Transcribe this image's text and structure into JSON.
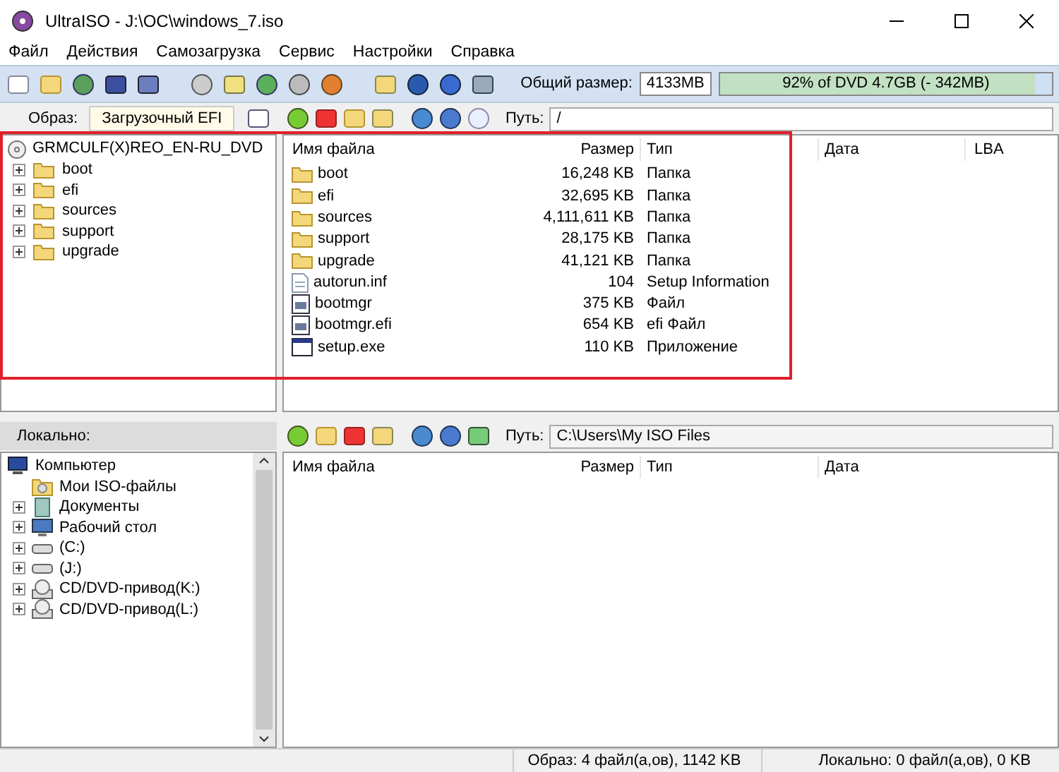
{
  "window": {
    "title": "UltraISO - J:\\OC\\windows_7.iso"
  },
  "menu": [
    "Файл",
    "Действия",
    "Самозагрузка",
    "Сервис",
    "Настройки",
    "Справка"
  ],
  "toolbar": {
    "total_label": "Общий размер:",
    "total_value": "4133MB",
    "capacity": {
      "reading": "92% of DVD 4.7GB (- 342MB)",
      "level": 0.95
    }
  },
  "image_bar": {
    "label": "Образ:",
    "boot_type": "Загрузочный EFI",
    "path_label": "Путь:",
    "path": "/"
  },
  "image_tree": {
    "root": "GRMCULF(X)REO_EN-RU_DVD",
    "children": [
      {
        "label": "boot",
        "expandable": true
      },
      {
        "label": "efi",
        "expandable": true
      },
      {
        "label": "sources",
        "expandable": true
      },
      {
        "label": "support",
        "expandable": true
      },
      {
        "label": "upgrade",
        "expandable": true
      }
    ]
  },
  "image_files": {
    "columns": [
      "Имя файла",
      "Размер",
      "Тип",
      "Дата",
      "LBA"
    ],
    "rows": [
      {
        "kind": "folder",
        "name": "boot",
        "size": "16,248 KB",
        "type": "Папка"
      },
      {
        "kind": "folder",
        "name": "efi",
        "size": "32,695 KB",
        "type": "Папка"
      },
      {
        "kind": "folder",
        "name": "sources",
        "size": "4,111,611 KB",
        "type": "Папка"
      },
      {
        "kind": "folder",
        "name": "support",
        "size": "28,175 KB",
        "type": "Папка"
      },
      {
        "kind": "folder",
        "name": "upgrade",
        "size": "41,121 KB",
        "type": "Папка"
      },
      {
        "kind": "text",
        "name": "autorun.inf",
        "size": "104",
        "type": "Setup Information"
      },
      {
        "kind": "binary",
        "name": "bootmgr",
        "size": "375 KB",
        "type": "Файл"
      },
      {
        "kind": "binary",
        "name": "bootmgr.efi",
        "size": "654 KB",
        "type": "efi Файл"
      },
      {
        "kind": "app",
        "name": "setup.exe",
        "size": "110 KB",
        "type": "Приложение"
      }
    ]
  },
  "local_bar": {
    "label": "Локально:",
    "path_label": "Путь:",
    "path": "C:\\Users\\My ISO Files"
  },
  "local_tree": {
    "root": "Компьютер",
    "children": [
      {
        "kind": "iso",
        "label": "Мои ISO-файлы",
        "expandable": false
      },
      {
        "kind": "docs",
        "label": "Документы",
        "expandable": true
      },
      {
        "kind": "desktop",
        "label": "Рабочий стол",
        "expandable": true
      },
      {
        "kind": "drive",
        "label": "(C:)",
        "expandable": true
      },
      {
        "kind": "drive",
        "label": "(J:)",
        "expandable": true
      },
      {
        "kind": "cd",
        "label": "CD/DVD-привод(K:)",
        "expandable": true
      },
      {
        "kind": "cd",
        "label": "CD/DVD-привод(L:)",
        "expandable": true
      }
    ]
  },
  "local_files": {
    "columns": [
      "Имя файла",
      "Размер",
      "Тип",
      "Дата"
    ]
  },
  "status_bar": {
    "image": "Образ: 4 файл(а,ов), 1142 KB",
    "local": "Локально: 0 файл(а,ов), 0 KB"
  }
}
